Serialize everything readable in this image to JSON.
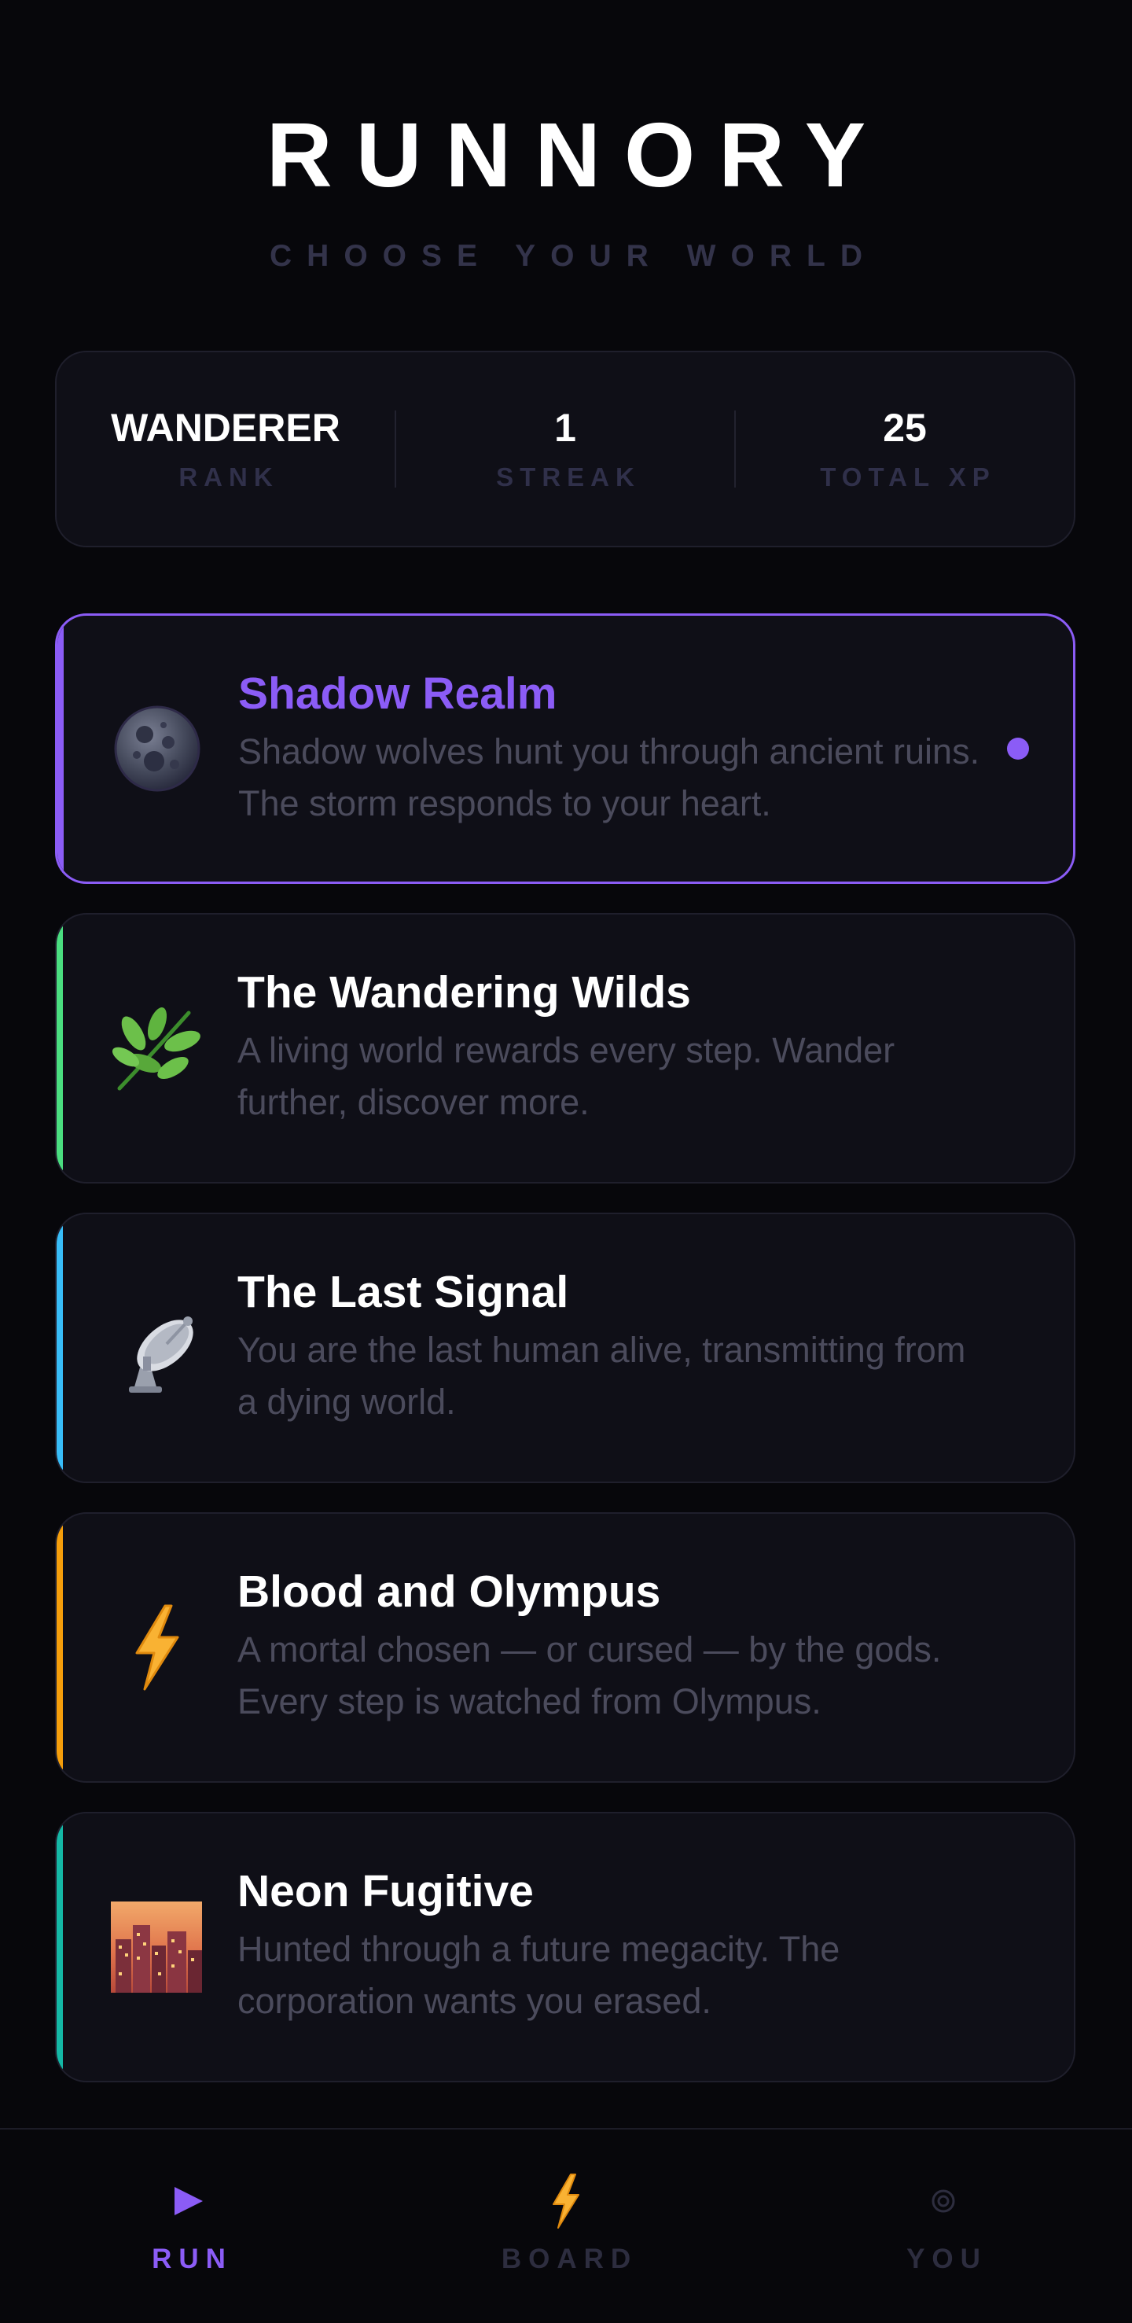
{
  "header": {
    "title": "RUNNORY",
    "subtitle": "CHOOSE YOUR WORLD"
  },
  "stats": [
    {
      "value": "WANDERER",
      "label": "RANK"
    },
    {
      "value": "1",
      "label": "STREAK"
    },
    {
      "value": "25",
      "label": "TOTAL XP"
    }
  ],
  "worlds": [
    {
      "name": "Shadow Realm",
      "description": "Shadow wolves hunt you through ancient ruins. The storm responds to your heart.",
      "icon": "moon-icon",
      "accent": "#8b5cf6",
      "selected": true
    },
    {
      "name": "The Wandering Wilds",
      "description": "A living world rewards every step. Wander further, discover more.",
      "icon": "herb-icon",
      "accent": "#4ade80",
      "selected": false
    },
    {
      "name": "The Last Signal",
      "description": "You are the last human alive, transmitting from a dying world.",
      "icon": "satellite-dish-icon",
      "accent": "#38bdf8",
      "selected": false
    },
    {
      "name": "Blood and Olympus",
      "description": "A mortal chosen — or cursed — by the gods. Every step is watched from Olympus.",
      "icon": "lightning-icon",
      "accent": "#f59e0b",
      "selected": false
    },
    {
      "name": "Neon Fugitive",
      "description": "Hunted through a future megacity. The corporation wants you erased.",
      "icon": "city-sunset-icon",
      "accent": "#14b8a6",
      "selected": false
    }
  ],
  "nav": {
    "items": [
      {
        "label": "RUN",
        "icon": "play-icon",
        "active": true
      },
      {
        "label": "BOARD",
        "icon": "lightning-icon",
        "active": false
      },
      {
        "label": "YOU",
        "icon": "profile-ring-icon",
        "active": false
      }
    ]
  },
  "colors": {
    "background": "#07070b",
    "card": "#0f0f17",
    "accent": "#8b5cf6",
    "muted": "#4b4b5c"
  }
}
